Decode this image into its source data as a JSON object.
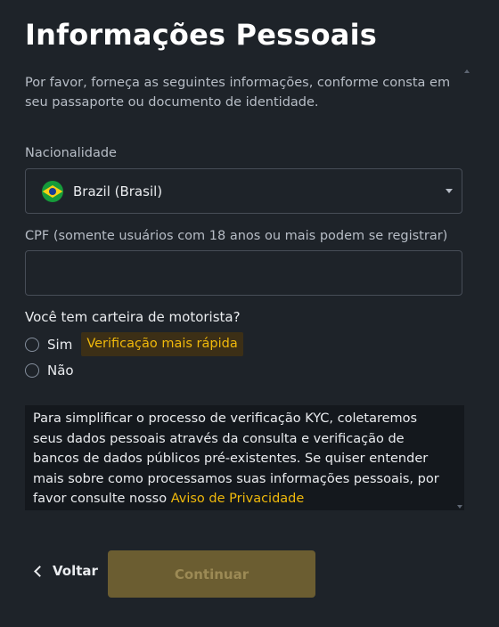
{
  "page": {
    "title": "Informações Pessoais",
    "subtitle": "Por favor, forneça as seguintes informações, conforme consta em seu passaporte ou documento de identidade."
  },
  "nationality": {
    "label": "Nacionalidade",
    "selected": "Brazil (Brasil)",
    "flag_icon": "brazil-flag-icon"
  },
  "cpf": {
    "label": "CPF (somente usuários com 18 anos ou mais podem se registrar)",
    "value": "",
    "placeholder": ""
  },
  "license": {
    "question": "Você tem carteira de motorista?",
    "options": [
      {
        "label": "Sim",
        "badge": "Verificação mais rápida",
        "selected": false
      },
      {
        "label": "Não",
        "selected": false
      }
    ]
  },
  "notice": {
    "text": "Para simplificar o processo de verificação KYC, coletaremos seus dados pessoais através da consulta e verificação de bancos de dados públicos pré-existentes. Se quiser entender mais sobre como processamos suas informações pessoais, por favor consulte nosso",
    "link": "Aviso de Privacidade"
  },
  "footer": {
    "back_label": "Voltar",
    "continue_label": "Continuar",
    "continue_enabled": false
  },
  "colors": {
    "background": "#1e2329",
    "accent": "#f0b90b",
    "disabled_button": "#6b5d31"
  }
}
